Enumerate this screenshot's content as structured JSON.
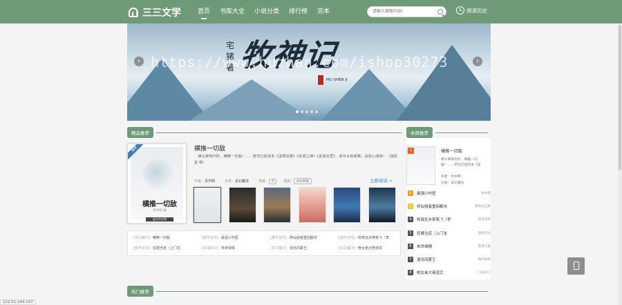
{
  "header": {
    "logo_text": "三三文学",
    "nav": [
      "首页",
      "书库大全",
      "小说分类",
      "排行榜",
      "完本"
    ],
    "search_placeholder": "请输入搜索内容!",
    "history_label": "阅读历史"
  },
  "banner": {
    "title_art": "牧神记",
    "side_text": "宅猪著",
    "pinyin": "MU SHEN JI",
    "watermark": "https://www.huzhan.com/ishop30273",
    "prev": "‹",
    "next": "›"
  },
  "recommend": {
    "section_label": "精品推荐",
    "cover": {
      "ribbon": "推荐",
      "title": "横推一切敌",
      "author": "月中阴 著",
      "publisher": "起点中文网"
    },
    "title": "横推一切敌",
    "desc": "　庚父宰舜升阶，横推一切敌！……老司已经完本《凌霄剑尊》《杀道之神》《武道天罡》，老书大有保障，请放心阅读！（凌辰星 荐）",
    "author_label": "作者：",
    "author": "月中阴",
    "category_label": "分类：",
    "category": "玄幻魔法",
    "heat_label": "热度：",
    "heat": "0",
    "update_label": "更新：",
    "update": "8分钟前",
    "read_now": "立即阅读 >"
  },
  "list_rows": [
    [
      {
        "cat": "[玄幻魔法]",
        "title": "横推一切敌"
      },
      {
        "cat": "[都市言情]",
        "title": "最强小村医"
      },
      {
        "cat": "[都市言情]",
        "title": "修仙强者重回都市"
      },
      {
        "cat": "[都市言情]",
        "title": "修真狂夫带我飞（李"
      }
    ],
    [
      {
        "cat": "[都市言情]",
        "title": "狂婿当道（上门龙"
      },
      {
        "cat": "[军事科幻]",
        "title": "末世绿帽"
      },
      {
        "cat": "[玄幻魔法]",
        "title": "混沌鸿蒙王"
      },
      {
        "cat": "[玄幻魔法]",
        "title": "绝女弟大佬道宗"
      }
    ]
  ],
  "rank": {
    "section_label": "本周推荐",
    "top": {
      "num": "1",
      "title": "横推一切敌",
      "desc": "庚父宰舜升阶，横推一切敌！……老司已经完本《凌",
      "author": "作者：月中阴",
      "category": "分类：玄幻魔法"
    },
    "items": [
      {
        "num": "2",
        "name": "最强小村医",
        "author": "水木帆"
      },
      {
        "num": "3",
        "name": "修仙强者重回都市",
        "author": "我和北王朱"
      },
      {
        "num": "4",
        "name": "修真狂夫带我飞（李",
        "author": "知水流罗"
      },
      {
        "num": "5",
        "name": "狂婿当道（上门龙",
        "author": "佳明对对"
      },
      {
        "num": "6",
        "name": "末世绿帽",
        "author": "莫莫大森"
      },
      {
        "num": "7",
        "name": "混沌鸿蒙王",
        "author": "微叶知秋"
      },
      {
        "num": "8",
        "name": "绝女弟大佬道宗",
        "author": "9号初二"
      }
    ]
  },
  "hot": {
    "section_label": "热门推荐"
  },
  "status_bar": "122.51.144.237",
  "colors": {
    "brand": "#6f9a78",
    "link": "#3b8ed0",
    "rank1": "#e8612c",
    "rank2": "#f2a31b",
    "rank3": "#f5c23a",
    "rankN": "#555555"
  }
}
